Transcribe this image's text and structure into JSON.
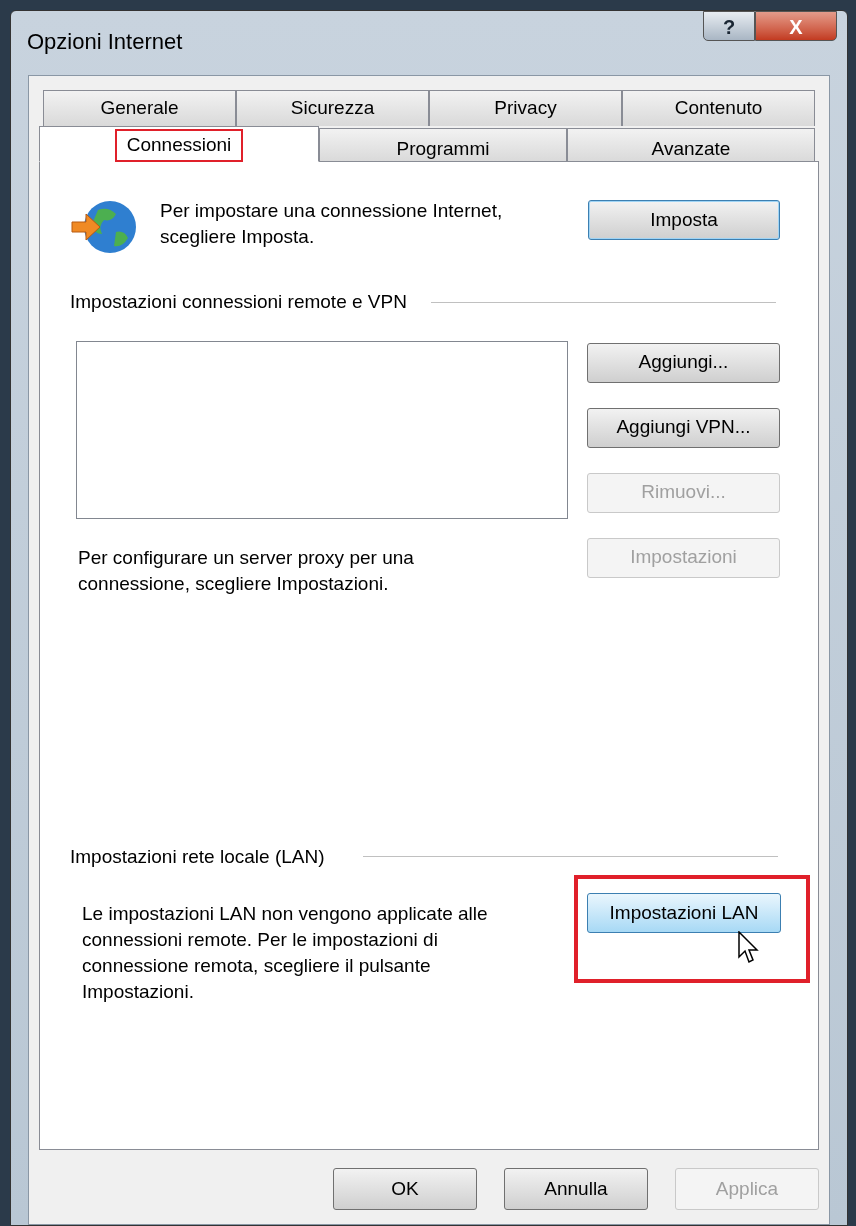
{
  "window": {
    "title": "Opzioni Internet",
    "help_button": "?",
    "close_button": "X"
  },
  "tabs_back": [
    {
      "label": "Generale",
      "selected": false
    },
    {
      "label": "Sicurezza",
      "selected": false
    },
    {
      "label": "Privacy",
      "selected": false
    },
    {
      "label": "Contenuto",
      "selected": false
    }
  ],
  "tabs_front": [
    {
      "label": "Connessioni",
      "selected": true,
      "highlighted": true
    },
    {
      "label": "Programmi",
      "selected": false,
      "highlighted": false
    },
    {
      "label": "Avanzate",
      "selected": false,
      "highlighted": false
    }
  ],
  "setup": {
    "text": "Per impostare una connessione Internet, scegliere Imposta.",
    "button": {
      "label": "Imposta",
      "default": true,
      "disabled": false,
      "hovered": false
    }
  },
  "remote_section": {
    "heading": "Impostazioni connessioni remote e VPN",
    "buttons": [
      {
        "label": "Aggiungi...",
        "disabled": false
      },
      {
        "label": "Aggiungi VPN...",
        "disabled": false
      },
      {
        "label": "Rimuovi...",
        "disabled": true
      },
      {
        "label": "Impostazioni",
        "disabled": true
      }
    ],
    "proxy_text": "Per configurare un server proxy per una connessione, scegliere Impostazioni."
  },
  "lan_section": {
    "heading": "Impostazioni rete locale (LAN)",
    "text": "Le impostazioni LAN non vengono applicate alle connessioni remote. Per le impostazioni di connessione remota, scegliere il pulsante Impostazioni.",
    "button": {
      "label": "Impostazioni LAN",
      "hovered": true,
      "disabled": false,
      "highlighted": true
    }
  },
  "footer_buttons": [
    {
      "label": "OK",
      "disabled": false
    },
    {
      "label": "Annulla",
      "disabled": false
    },
    {
      "label": "Applica",
      "disabled": true
    }
  ]
}
